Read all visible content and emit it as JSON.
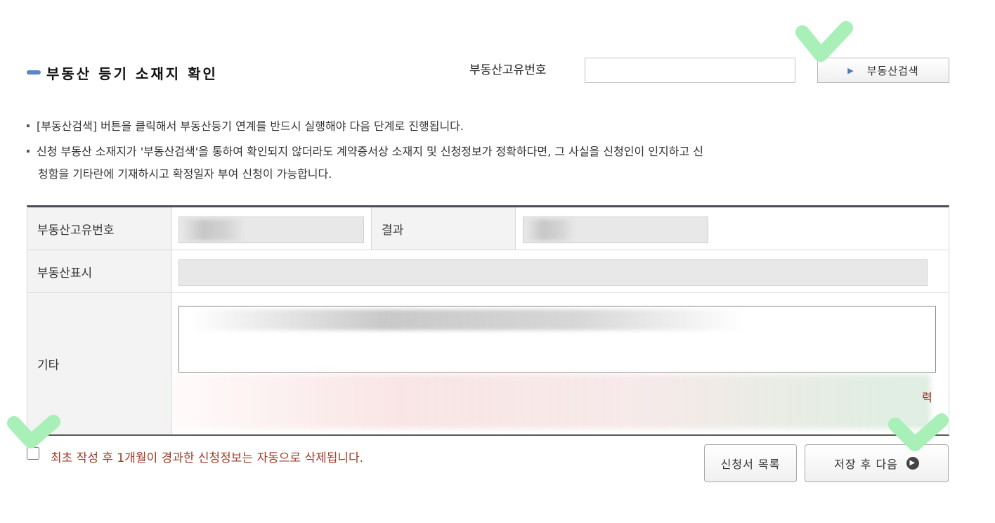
{
  "header": {
    "title": "부동산 등기 소재지 확인",
    "search_label": "부동산고유번호",
    "search_input_value": "",
    "search_button_label": "부동산검색",
    "search_button_icon": "arrow-right-icon"
  },
  "notices": [
    "[부동산검색] 버튼을 클릭해서 부동산등기 연계를 반드시 실행해야 다음 단계로 진행됩니다.",
    "신청 부동산 소재지가 '부동산검색'을 통하여 확인되지 않더라도 계약증서상 소재지 및 신청정보가 정확하다면, 그 사실을 신청인이 인지하고 신",
    "청함을 기타란에 기재하시고 확정일자 부여 신청이 가능합니다."
  ],
  "table": {
    "label_id": "부동산고유번호",
    "label_result": "결과",
    "label_display": "부동산표시",
    "label_etc": "기타",
    "char_count_fragment": "력"
  },
  "footer": {
    "auto_delete_text": "최초 작성 후 1개월이 경과한 신청정보는 자동으로 삭제됩니다.",
    "list_button_label": "신청서 목록",
    "save_next_button_label": "저장 후 다음",
    "next_icon": "chevron-right-circle-icon"
  },
  "colors": {
    "accent_blue": "#5b86c4",
    "notice_red": "#a23a28",
    "check_green": "#a8f0b8"
  }
}
